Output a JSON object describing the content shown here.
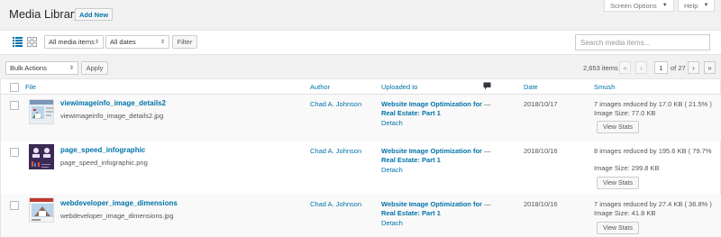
{
  "header": {
    "title": "Media Library",
    "add_new": "Add New",
    "screen_options": "Screen Options",
    "help": "Help"
  },
  "filters": {
    "media_type": "All media items",
    "dates": "All dates",
    "filter_button": "Filter",
    "search_placeholder": "Search media items..."
  },
  "bulk": {
    "action": "Bulk Actions",
    "apply": "Apply"
  },
  "pagination": {
    "count": "2,653 items",
    "first": "«",
    "prev": "‹",
    "current_page": "1",
    "of_total": "of 27",
    "next": "›",
    "last": "»"
  },
  "columns": {
    "file": "File",
    "author": "Author",
    "uploaded_to": "Uploaded to",
    "date": "Date",
    "smush": "Smush"
  },
  "rows": [
    {
      "title": "viewimageinfo_image_details2",
      "filename": "viewimageinfo_image_details2.jpg",
      "author": "Chad A. Johnson",
      "uploaded_to": "Website Image Optimization for Real Estate: Part 1",
      "detach": "Detach",
      "comments": "—",
      "date": "2018/10/17",
      "smush_line1": "7 images reduced by 17.0 KB ( 21.5% )",
      "smush_line2": "Image Size: 77.0 KB",
      "view_stats": "View Stats"
    },
    {
      "title": "page_speed_infographic",
      "filename": "page_speed_infographic.png",
      "author": "Chad A. Johnson",
      "uploaded_to": "Website Image Optimization for Real Estate: Part 1",
      "detach": "Detach",
      "comments": "—",
      "date": "2018/10/16",
      "smush_line1": "8 images reduced by 195.6 KB ( 79.7%",
      "smush_line2": "Image Size: 299.8 KB",
      "view_stats": "View Stats"
    },
    {
      "title": "webdeveloper_image_dimensions",
      "filename": "webdeveloper_image_dimensions.jpg",
      "author": "Chad A. Johnson",
      "uploaded_to": "Website Image Optimization for Real Estate: Part 1",
      "detach": "Detach",
      "comments": "—",
      "date": "2018/10/16",
      "smush_line1": "7 images reduced by 27.4 KB ( 36.8% )",
      "smush_line2": "Image Size: 41.8 KB",
      "view_stats": "View Stats"
    }
  ],
  "colors": {
    "link": "#0073aa",
    "background": "#f1f1f1",
    "accent": "#0085ba"
  }
}
